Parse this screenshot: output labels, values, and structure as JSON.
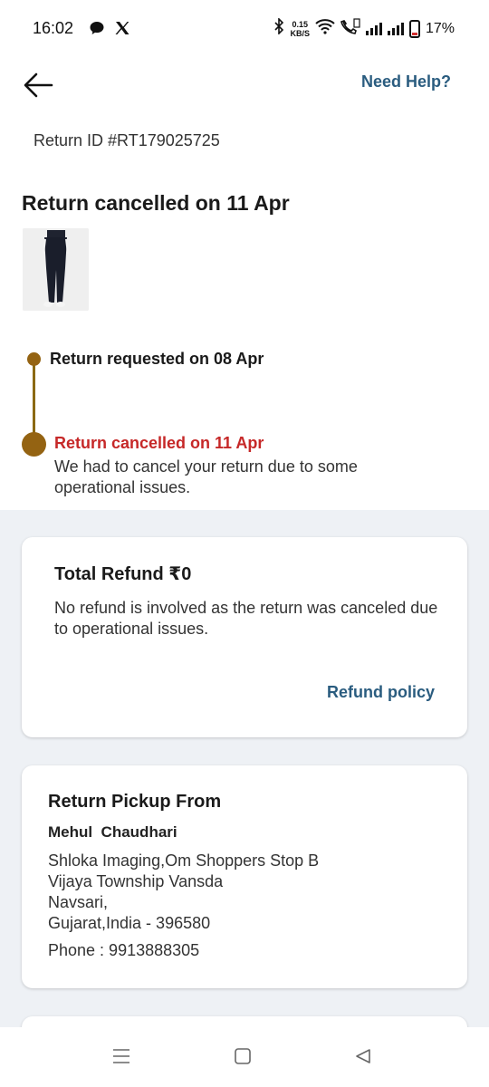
{
  "status_bar": {
    "time": "16:02",
    "net_speed_value": "0.15",
    "net_speed_unit": "KB/S",
    "battery": "17%",
    "left_icons": [
      "chat-bubble-icon",
      "x-logo-icon"
    ],
    "right_icons": [
      "bluetooth-icon",
      "wifi-icon",
      "volte-call-icon",
      "signal-icon",
      "signal-icon",
      "battery-icon"
    ]
  },
  "header": {
    "back_icon": "arrow-left-icon",
    "help_label": "Need Help?"
  },
  "return_id": "Return ID #RT179025725",
  "status_heading": "Return cancelled on 11 Apr",
  "timeline": {
    "step1_label": "Return requested on 08 Apr",
    "step2_label": "Return cancelled on 11 Apr",
    "step2_desc": "We had to cancel your return due to some operational issues."
  },
  "refund_card": {
    "title": "Total Refund ₹0",
    "description": "No refund is involved as the return was canceled due to operational issues.",
    "policy_link": "Refund policy"
  },
  "pickup_card": {
    "title": "Return Pickup From",
    "name": "Mehul  Chaudhari",
    "address_lines": [
      "Shloka Imaging,Om Shoppers Stop B",
      "Vijaya Township Vansda",
      "Navsari,",
      "Gujarat,India - 396580"
    ],
    "phone": "Phone : 9913888305"
  },
  "nav_bar": {
    "icons": [
      "menu-icon",
      "home-square-icon",
      "back-triangle-icon"
    ]
  },
  "colors": {
    "accent_link": "#2a5c7f",
    "timeline": "#946312",
    "cancel_red": "#c62828",
    "section_bg": "#eef1f5"
  }
}
